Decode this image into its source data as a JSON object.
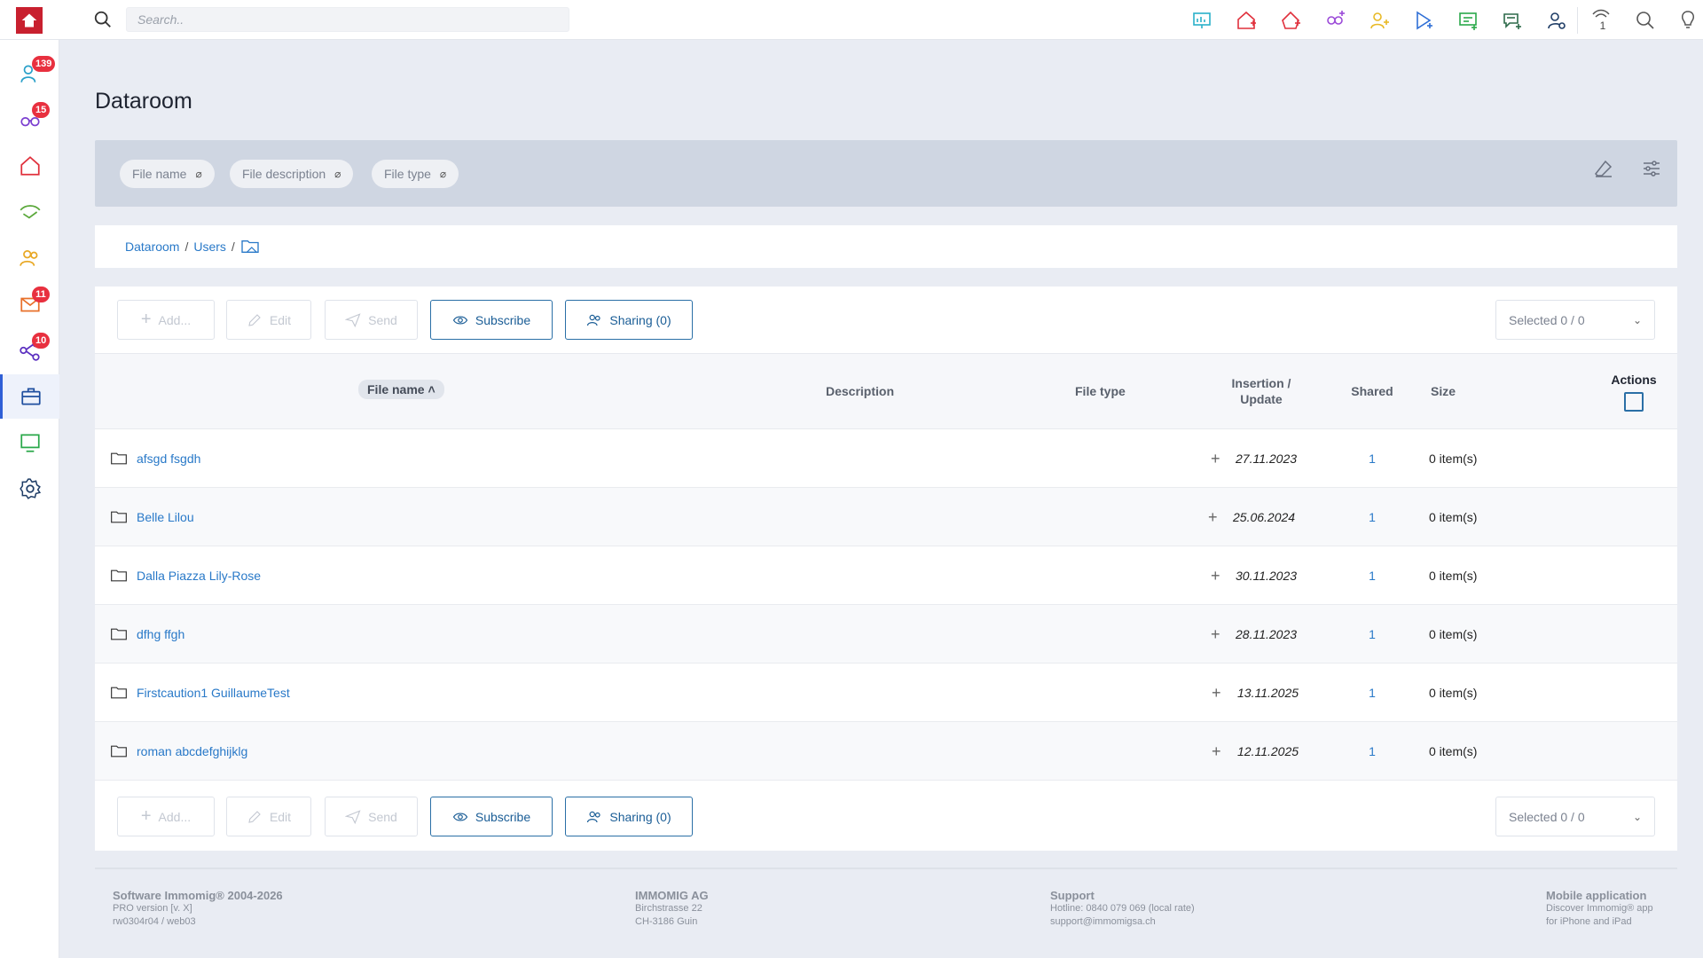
{
  "search": {
    "placeholder": "Search.."
  },
  "notifications": {
    "count": "1"
  },
  "sidebar": {
    "badges": {
      "contacts": "139",
      "visits": "15",
      "mail": "11",
      "network": "10"
    }
  },
  "page": {
    "title": "Dataroom"
  },
  "filters": {
    "chips": [
      "File name",
      "File description",
      "File type"
    ],
    "clear_symbol": "⌀"
  },
  "breadcrumb": {
    "items": [
      "Dataroom",
      "Users"
    ],
    "separator": "/"
  },
  "toolbar": {
    "add": "Add...",
    "edit": "Edit",
    "send": "Send",
    "subscribe": "Subscribe",
    "sharing": "Sharing (0)",
    "selected": "Selected 0 / 0"
  },
  "table": {
    "headers": {
      "file_name": "File name",
      "description": "Description",
      "file_type": "File type",
      "insertion": "Insertion /",
      "update": "Update",
      "shared": "Shared",
      "size": "Size",
      "actions": "Actions"
    },
    "rows": [
      {
        "name": "afsgd fsgdh",
        "date": "27.11.2023",
        "shared": "1",
        "size": "0 item(s)"
      },
      {
        "name": "Belle Lilou",
        "date": "25.06.2024",
        "shared": "1",
        "size": "0 item(s)"
      },
      {
        "name": "Dalla Piazza Lily-Rose",
        "date": "30.11.2023",
        "shared": "1",
        "size": "0 item(s)"
      },
      {
        "name": "dfhg ffgh",
        "date": "28.11.2023",
        "shared": "1",
        "size": "0 item(s)"
      },
      {
        "name": "Firstcaution1 GuillaumeTest",
        "date": "13.11.2025",
        "shared": "1",
        "size": "0 item(s)"
      },
      {
        "name": "roman abcdefghijklg",
        "date": "12.11.2025",
        "shared": "1",
        "size": "0 item(s)"
      }
    ]
  },
  "footer": {
    "software": {
      "title": "Software Immomig® 2004-2026",
      "line1": "PRO version [v. X]",
      "line2": "rw0304r04 / web03"
    },
    "company": {
      "title": "IMMOMIG AG",
      "line1": "Birchstrasse 22",
      "line2": "CH-3186 Guin"
    },
    "support": {
      "title": "Support",
      "line1": "Hotline: 0840 079 069 (local rate)",
      "line2": "support@immomigsa.ch"
    },
    "mobile": {
      "title": "Mobile application",
      "line1": "Discover Immomig® app",
      "line2": "for iPhone and iPad"
    }
  },
  "colors": {
    "brand": "#c8202f",
    "link": "#2979c8",
    "badge": "#e8303f",
    "accent": "#2a6fa6"
  }
}
